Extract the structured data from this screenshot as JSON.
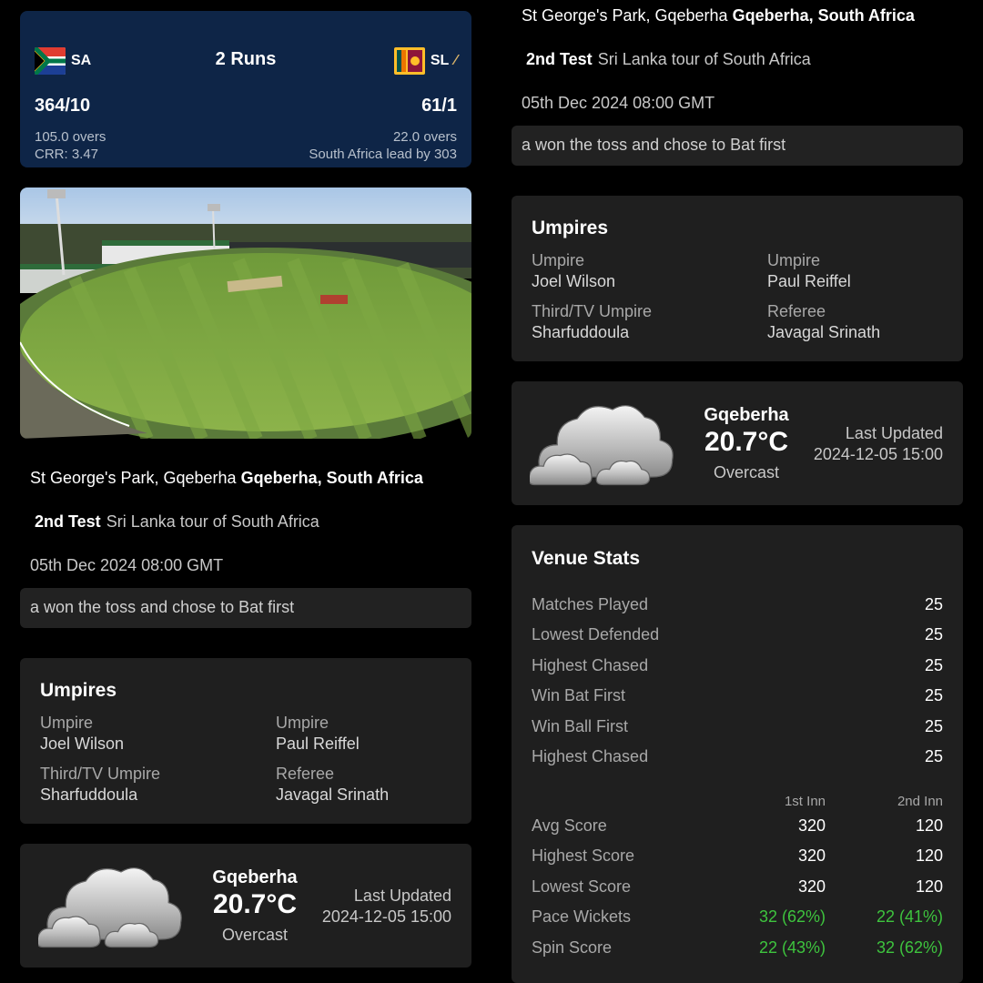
{
  "score_card": {
    "team1": "SA",
    "team2": "SL",
    "result": "2 Runs",
    "team1_score": "364/10",
    "team1_overs": "105.0 overs",
    "team1_crr": "CRR: 3.47",
    "team2_score": "61/1",
    "team2_overs": "22.0 overs",
    "lead_text": "South Africa lead by 303"
  },
  "match_info": {
    "ground": "St George's Park, Gqeberha",
    "location": "Gqeberha, South Africa",
    "match": "2nd Test",
    "series": "Sri Lanka tour of South Africa",
    "datetime": "05th Dec 2024 08:00 GMT",
    "toss": "a won the toss and chose to Bat first"
  },
  "umpires": {
    "title": "Umpires",
    "umpire1_label": "Umpire",
    "umpire1_name": "Joel Wilson",
    "umpire2_label": "Umpire",
    "umpire2_name": "Paul Reiffel",
    "tv_label": "Third/TV Umpire",
    "tv_name": "Sharfuddoula",
    "referee_label": "Referee",
    "referee_name": "Javagal Srinath"
  },
  "weather": {
    "icon": "cloud-icon",
    "city": "Gqeberha",
    "temp": "20.7°C",
    "condition": "Overcast",
    "updated_label": "Last Updated",
    "updated_time": "2024-12-05 15:00"
  },
  "venue_stats": {
    "title": "Venue Stats",
    "rows": [
      {
        "label": "Matches Played",
        "value": "25"
      },
      {
        "label": "Lowest Defended",
        "value": "25"
      },
      {
        "label": "Highest Chased",
        "value": "25"
      },
      {
        "label": "Win Bat First",
        "value": "25"
      },
      {
        "label": "Win Ball First",
        "value": "25"
      },
      {
        "label": "Highest Chased",
        "value": "25"
      }
    ],
    "col1_header": "1st Inn",
    "col2_header": "2nd Inn",
    "innings_rows": [
      {
        "label": "Avg Score",
        "first": "320",
        "second": "120"
      },
      {
        "label": "Highest Score",
        "first": "320",
        "second": "120"
      },
      {
        "label": "Lowest Score",
        "first": "320",
        "second": "120"
      },
      {
        "label": "Pace Wickets",
        "first": "32 (62%)",
        "second": "22 (41%)"
      },
      {
        "label": "Spin Score",
        "first": "22 (43%)",
        "second": "32 (62%)"
      }
    ]
  },
  "colors": {
    "score_card_bg": "#0e2547",
    "card_bg": "#1f1f1f",
    "highlight_green": "#3ec43e"
  }
}
